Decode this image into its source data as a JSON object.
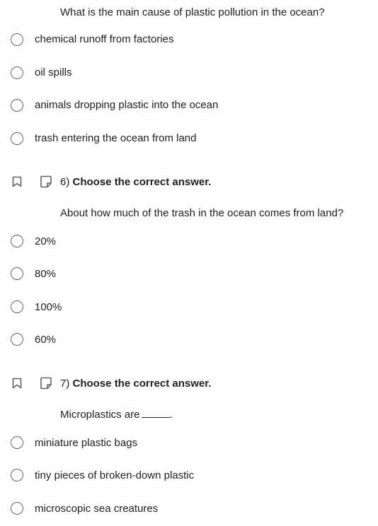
{
  "q5": {
    "prompt": "What is the main cause of plastic pollution in the ocean?",
    "options": [
      "chemical runoff from factories",
      "oil spills",
      "animals dropping plastic into the ocean",
      "trash entering the ocean from land"
    ]
  },
  "q6": {
    "number": "6)",
    "instruction": "Choose the correct answer.",
    "prompt": "About how much of the trash in the ocean comes from land?",
    "options": [
      "20%",
      "80%",
      "100%",
      "60%"
    ]
  },
  "q7": {
    "number": "7)",
    "instruction": "Choose the correct answer.",
    "prompt": "Microplastics are",
    "prompt_end": ".",
    "options": [
      "miniature plastic bags",
      "tiny pieces of broken-down plastic",
      "microscopic sea creatures"
    ]
  },
  "icons": {
    "bookmark": "bookmark-icon",
    "note": "note-icon",
    "radio": "radio-button"
  },
  "colors": {
    "text": "#202124",
    "icon": "#5f6368"
  }
}
